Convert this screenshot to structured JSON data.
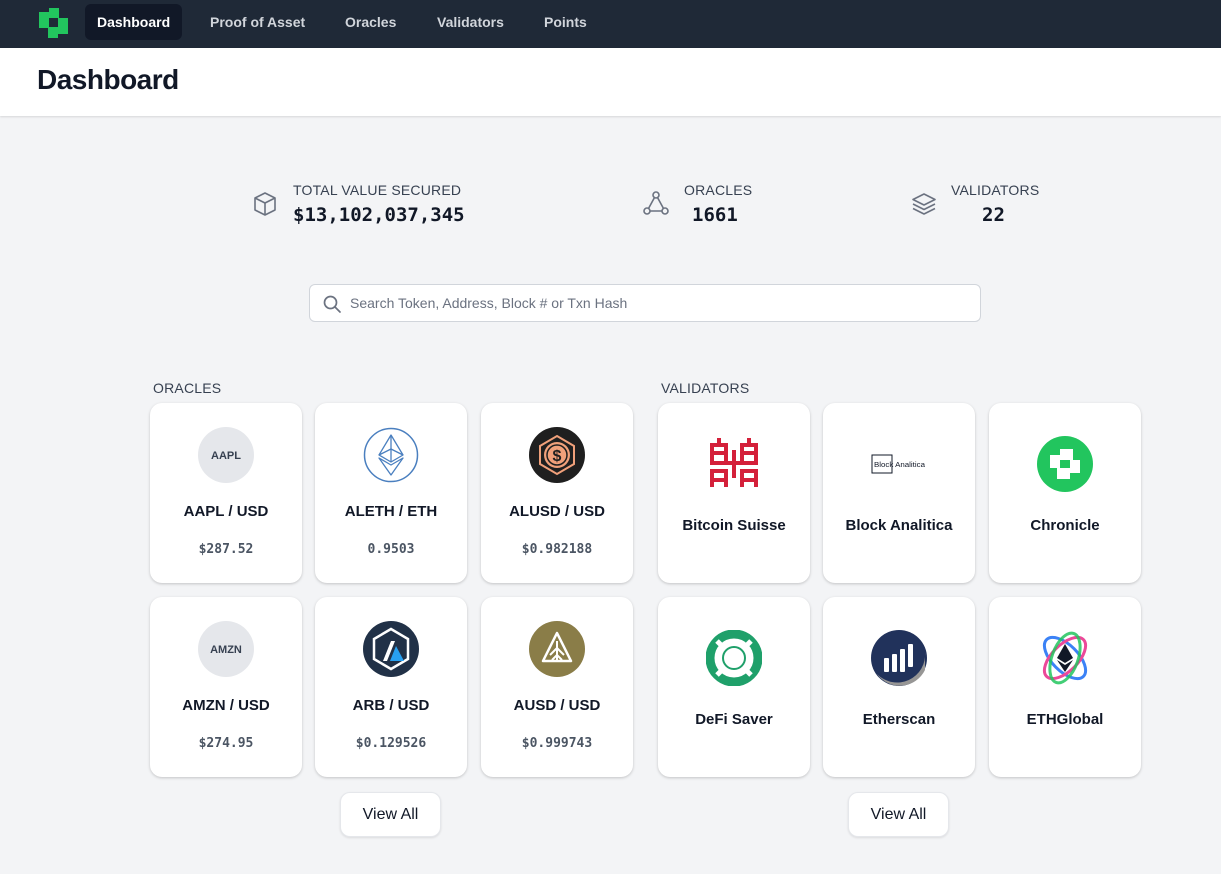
{
  "nav": {
    "logo_icon": "chronicle-logo-icon",
    "items": [
      {
        "label": "Dashboard",
        "active": true
      },
      {
        "label": "Proof of Asset",
        "active": false
      },
      {
        "label": "Oracles",
        "active": false
      },
      {
        "label": "Validators",
        "active": false
      },
      {
        "label": "Points",
        "active": false
      }
    ]
  },
  "header": {
    "title": "Dashboard"
  },
  "stats": [
    {
      "icon": "cube-icon",
      "label": "TOTAL VALUE SECURED",
      "value": "$13,102,037,345"
    },
    {
      "icon": "nodes-icon",
      "label": "ORACLES",
      "value": "1661"
    },
    {
      "icon": "layers-icon",
      "label": "VALIDATORS",
      "value": "22"
    }
  ],
  "search": {
    "placeholder": "Search Token, Address, Block # or Txn Hash",
    "value": ""
  },
  "oracles": {
    "title": "ORACLES",
    "items": [
      {
        "logo_text": "AAPL",
        "name": "AAPL / USD",
        "price": "$287.52"
      },
      {
        "logo": "ethereum-icon",
        "name": "ALETH / ETH",
        "price": "0.9503"
      },
      {
        "logo": "alusd-icon",
        "name": "ALUSD / USD",
        "price": "$0.982188"
      },
      {
        "logo_text": "AMZN",
        "name": "AMZN / USD",
        "price": "$274.95"
      },
      {
        "logo": "arbitrum-icon",
        "name": "ARB / USD",
        "price": "$0.129526"
      },
      {
        "logo": "ausd-icon",
        "name": "AUSD / USD",
        "price": "$0.999743"
      }
    ],
    "view_all": "View All"
  },
  "validators": {
    "title": "VALIDATORS",
    "items": [
      {
        "logo": "bitcoin-suisse-icon",
        "name": "Bitcoin Suisse"
      },
      {
        "logo": "block-analitica-icon",
        "logo_text": "Block Analitica",
        "name": "Block Analitica"
      },
      {
        "logo": "chronicle-icon",
        "name": "Chronicle"
      },
      {
        "logo": "defi-saver-icon",
        "name": "DeFi Saver"
      },
      {
        "logo": "etherscan-icon",
        "name": "Etherscan"
      },
      {
        "logo": "ethglobal-icon",
        "name": "ETHGlobal"
      }
    ],
    "view_all": "View All"
  },
  "colors": {
    "nav_bg": "#1f2937",
    "brand_green": "#22c55e",
    "page_bg": "#f3f4f6"
  }
}
